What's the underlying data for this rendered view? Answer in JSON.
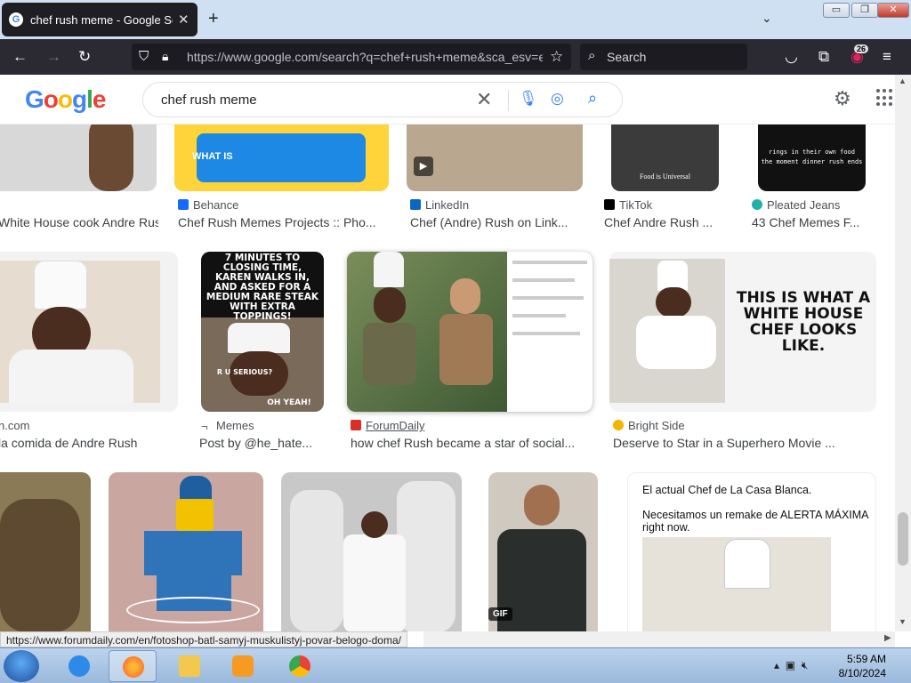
{
  "tab": {
    "title": "chef rush meme - Google Search",
    "favicon": "G"
  },
  "window": {
    "min": "▭",
    "max": "❐",
    "close": "✕"
  },
  "toolbar": {
    "url": "https://www.google.com/search?q=chef+rush+meme&sca_esv=e",
    "search_placeholder": "Search",
    "badge": "26"
  },
  "google": {
    "logo": "Google",
    "query": "chef rush meme"
  },
  "row1": [
    {
      "source": "",
      "caption": "White House cook Andre Rush...",
      "color": "#c8c8c8"
    },
    {
      "source": "Behance",
      "caption": "Chef Rush Memes Projects :: Pho...",
      "color": "#ffd43a"
    },
    {
      "source": "LinkedIn",
      "caption": "Chef (Andre) Rush on Link...",
      "color": "#b9a88f"
    },
    {
      "source": "TikTok",
      "caption": "Chef Andre Rush ...",
      "color": "#3b3b3b",
      "text": "Food is Universal"
    },
    {
      "source": "Pleated Jeans",
      "caption": "43 Chef Memes F...",
      "color": "#111",
      "text": "rings in their own food\nthe moment dinner rush ends"
    }
  ],
  "row2": [
    {
      "source": "n.com",
      "caption": "la comida de Andre Rush",
      "color": "#e8e4de"
    },
    {
      "source": "Memes",
      "caption": "Post by @he_hate...",
      "color": "#7a6a5a",
      "top_text": "7 MINUTES TO CLOSING TIME, KAREN WALKS IN, AND ASKED FOR A MEDIUM RARE STEAK WITH EXTRA TOPPINGS!",
      "mid_text": "R U SERIOUS?",
      "bot_text": "OH YEAH!"
    },
    {
      "source": "ForumDaily",
      "caption": "how chef Rush became a star of social...",
      "color": "#5a7a4a"
    },
    {
      "source": "Bright Side",
      "caption": "Deserve to Star in a Superhero Movie ...",
      "color": "#f4f4f4",
      "text": "THIS IS WHAT A WHITE HOUSE CHEF LOOKS LIKE."
    }
  ],
  "row3": [
    {
      "color": "#8a7a55"
    },
    {
      "color": "#c9a7a0"
    },
    {
      "color": "#c0c0c0"
    },
    {
      "color": "#cfc9c0",
      "badge": "GIF"
    },
    {
      "color": "#fff",
      "text1": "El actual Chef de La Casa Blanca.",
      "text2": "Necesitamos un remake de ALERTA MÁXIMA right now."
    }
  ],
  "status_url": "https://www.forumdaily.com/en/fotoshop-batl-samyj-muskulistyj-povar-belogo-doma/",
  "clock": {
    "time": "5:59 AM",
    "date": "8/10/2024"
  }
}
